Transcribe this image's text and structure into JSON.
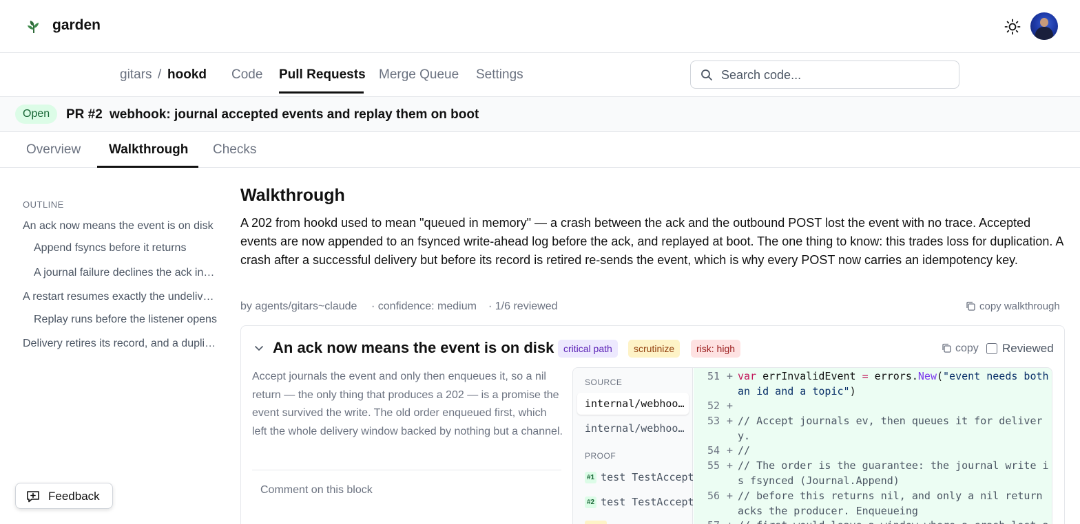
{
  "app": {
    "brand": "garden",
    "logo_icon": "leaf-icon",
    "theme_icon": "sun-icon"
  },
  "repo": {
    "owner": "gitars",
    "separator": "/",
    "name": "hookd",
    "tabs": [
      {
        "label": "Code",
        "active": false
      },
      {
        "label": "Pull Requests",
        "active": true
      },
      {
        "label": "Merge Queue",
        "active": false
      },
      {
        "label": "Settings",
        "active": false
      }
    ],
    "search_placeholder": "Search code..."
  },
  "pr": {
    "status": "Open",
    "number": "PR #2",
    "title": "webhook: journal accepted events and replay them on boot",
    "tabs": [
      {
        "label": "Overview",
        "active": false
      },
      {
        "label": "Walkthrough",
        "active": true
      },
      {
        "label": "Checks",
        "active": false
      }
    ]
  },
  "outline": {
    "heading": "OUTLINE",
    "items": [
      {
        "label": "An ack now means the event is on disk",
        "level": 0
      },
      {
        "label": "Append fsyncs before it returns",
        "level": 1
      },
      {
        "label": "A journal failure declines the ack instead of faking it",
        "level": 1
      },
      {
        "label": "A restart resumes exactly the undelivered events",
        "level": 0
      },
      {
        "label": "Replay runs before the listener opens",
        "level": 1
      },
      {
        "label": "Delivery retires its record, and a duplicate is the price",
        "level": 0
      }
    ]
  },
  "walkthrough": {
    "title": "Walkthrough",
    "summary": "A 202 from hookd used to mean \"queued in memory\" — a crash between the ack and the outbound POST lost the event with no trace. Accepted events are now appended to an fsynced write-ahead log before the ack, and replayed at boot. The one thing to know: this trades loss for duplication. A crash after a successful delivery but before its record is retired re-sends the event, which is why every POST now carries an idempotency key.",
    "meta": {
      "author": "by agents/gitars~claude",
      "confidence": "· confidence: medium",
      "reviewed": "· 1/6 reviewed"
    },
    "copy_label": "copy walkthrough"
  },
  "block": {
    "title": "An ack now means the event is on disk",
    "tags": [
      "critical path",
      "scrutinize",
      "risk: high"
    ],
    "copy_label": "copy",
    "reviewed_label": "Reviewed",
    "reviewed": false,
    "description": "Accept journals the event and only then enqueues it, so a nil return — the only thing that produces a 202 — is a promise the event survived the write. The old order enqueued first, which left the whole delivery window backed by nothing but a channel.",
    "comment_placeholder": "Comment on this block",
    "source_label": "SOURCE",
    "source_files": [
      "internal/webhook/accept.go",
      "internal/webhook/journal.go"
    ],
    "proof_label": "PROOF",
    "proofs": [
      {
        "num": "#1",
        "label": "test TestAccept"
      },
      {
        "num": "#2",
        "label": "test TestAccept"
      }
    ],
    "code_lines": [
      {
        "ln": "51",
        "text": "var errInvalidEvent = errors.New(\"event needs both an id and a topic\")"
      },
      {
        "ln": "52",
        "text": ""
      },
      {
        "ln": "53",
        "text": "// Accept journals ev, then queues it for delivery."
      },
      {
        "ln": "54",
        "text": "//"
      },
      {
        "ln": "55",
        "text": "// The order is the guarantee: the journal write is fsynced (Journal.Append)"
      },
      {
        "ln": "56",
        "text": "// before this returns nil, and only a nil return acks the producer. Enqueueing"
      },
      {
        "ln": "57",
        "text": "// first would leave a window where a crash lost an acked event."
      }
    ]
  },
  "feedback": {
    "label": "Feedback"
  },
  "colors": {
    "accent": "#111111",
    "open_badge_bg": "#dcfce7",
    "open_badge_fg": "#166534",
    "diff_add_bg": "#ecfdf3",
    "tag_critical": "#ede9fe",
    "tag_scrutinize": "#fef3c7",
    "tag_risk": "#fee2e2"
  }
}
